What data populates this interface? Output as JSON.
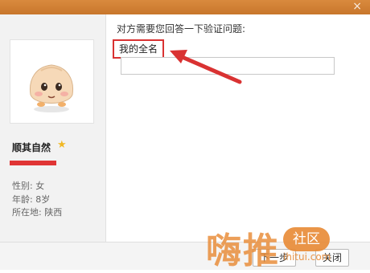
{
  "window": {
    "title": "",
    "close_glyph": "×"
  },
  "profile": {
    "name": "顺其自然",
    "gender": "性别: 女",
    "age": "年龄: 8岁",
    "location": "所在地:  陕西"
  },
  "verification": {
    "question_label": "对方需要您回答一下验证问题:",
    "answer_hint": "我的全名",
    "input_value": ""
  },
  "buttons": {
    "next": "下一步",
    "close": "关闭"
  },
  "watermark": {
    "text": "嗨推",
    "badge": "社区",
    "url": "ihitui.com"
  },
  "colors": {
    "titlebar": "#d98a3e",
    "highlight": "#d93232",
    "watermark": "#e88a35"
  }
}
